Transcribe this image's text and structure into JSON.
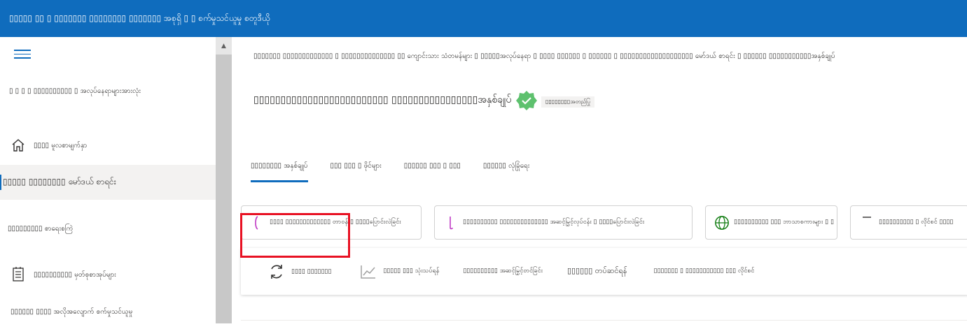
{
  "header": {
    "title": "▯▯▯▯▯ ▯▯ ▯ ▯▯▯▯▯▯▯ ▯▯▯▯▯▯▯▯ ▯▯▯▯▯▯▯ အစုရှိ ▯ ▯ စက်မှုသင်ယူမှု စတူဒီယို"
  },
  "sidebar": {
    "heading": "▯ ▯ ▯ ▯ ▯▯▯▯▯▯▯▯▯▯ ▯ အလုပ်နေရာများအားလုံး",
    "items": [
      {
        "label": "▯▯▯▯ မူလစာမျက်နှာ",
        "icon": "home-icon"
      },
      {
        "label": "▯▯▯▯▯ ▯▯▯▯▯▯▯▯ မော်ဒယ် စာရင်း",
        "icon": "none",
        "active": true
      },
      {
        "label": "▯▯▯▯▯▯▯▯▯ စာရေးစကြဲ",
        "icon": "none"
      },
      {
        "label": "▯▯▯▯▯▯▯▯▯▯ မှတ်စုစာအုပ်များ",
        "icon": "notebook-icon"
      },
      {
        "label": "▯▯▯▯▯▯ ▯▯▯▯ အလိုအလျောက် စက်မှုသင်ယူမှု",
        "icon": "none"
      }
    ]
  },
  "main": {
    "breadcrumb": "▯▯▯▯▯▯▯ ▯▯▯▯▯▯▯▯▯▯▯▯▯ ▯ ▯▯▯▯▯▯▯▯▯▯▯▯▯▯ ▯▯ ကျောင်းသား သံတမန်များ ▯ ▯▯▯▯▯အလုပ်နေရာ ▯   ▯▯▯▯ ▯▯▯▯▯▯ ▯ ▯▯▯▯▯▯ ▯ ▯▯▯▯▯▯▯▯▯▯▯▯▯▯▯▯▯▯▯ မော်ဒယ် စာရင်း ▯ ▯▯▯▯▯▯ ▯▯▯▯▯▯▯▯▯▯▯အနှစ်ချုပ်",
    "title": "▯▯▯▯▯▯▯▯▯▯▯▯▯▯▯▯▯▯▯▯▯▯▯▯▯ ▯▯▯▯▯▯▯▯▯▯▯▯▯▯▯▯အနှစ်ချုပ်",
    "verified_label": "▯▯▯▯▯▯▯▯အတည်ပြု",
    "tabs": [
      {
        "label": "▯▯▯▯▯▯▯▯ အနှစ်ချုပ်",
        "active": true
      },
      {
        "label": "▯▯▯ ▯▯▯ ▯ ဖိုင်များ"
      },
      {
        "label": "▯▯▯▯▯▯ ▯▯▯ ▯ ▯▯▯"
      },
      {
        "label": "▯▯▯▯▯▯ လုံခြုံရေး"
      }
    ],
    "cards": [
      {
        "label": "▯▯▯▯ ▯▯▯▯▯▯▯▯▯▯▯▯▯ တာဝန် ▯ ▯▯▯▯ပြောင်းလဲခြင်း",
        "icon": "task-icon"
      },
      {
        "label": "▯▯▯▯▯▯▯▯▯▯ ▯▯▯▯▯▯▯▯▯▯▯▯▯▯ အဆင့်မြှင့်လုပ်ငန်း ▯ ▯▯▯▯ပြောင်းလဲခြင်း",
        "icon": "finetune-icon"
      },
      {
        "label": "▯▯▯▯▯▯▯▯▯▯ ▯▯▯ ဘာသာစကားများ ▯ ▯",
        "icon": "globe-icon"
      },
      {
        "label": "▯▯▯▯▯▯▯▯▯▯ ▯ လိုင်စင် ▯▯▯▯",
        "icon": "license-icon"
      }
    ],
    "toolbar": [
      {
        "label": "▯▯▯▯ ▯▯▯▯▯▯▯",
        "icon": "refresh-icon"
      },
      {
        "label": "▯▯▯▯▯ ▯▯▯ သုံးသပ်ရန်",
        "icon": "chart-icon"
      },
      {
        "label": "▯▯▯▯▯▯▯▯▯▯ အဆင့်မြှင့်တင်ခြင်း",
        "icon": "none"
      },
      {
        "label": "▯▯▯▯▯▯ တပ်ဆင်ရန်",
        "icon": "none"
      },
      {
        "label": "▯▯▯▯▯▯▯ ▯ ▯▯▯▯▯▯▯▯▯▯▯ ▯▯▯ လိုင်စင်",
        "icon": "none"
      }
    ]
  }
}
